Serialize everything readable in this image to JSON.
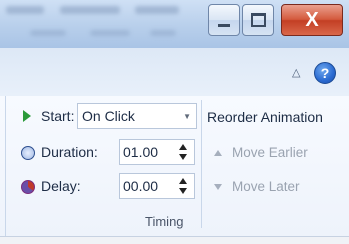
{
  "window": {
    "controls": {
      "minimize_icon": "minimize-icon",
      "maximize_icon": "maximize-icon",
      "close_label": "X"
    },
    "accent_close": "#d0523a"
  },
  "ribbon": {
    "collapse_icon": "caret-up-icon",
    "help_label": "?"
  },
  "timing": {
    "start": {
      "label": "Start:",
      "value": "On Click",
      "icon": "play-icon"
    },
    "duration": {
      "label": "Duration:",
      "value": "01.00",
      "icon": "clock-icon"
    },
    "delay": {
      "label": "Delay:",
      "value": "00.00",
      "icon": "delay-icon"
    },
    "group_label": "Timing"
  },
  "reorder": {
    "title": "Reorder Animation",
    "move_earlier": "Move Earlier",
    "move_later": "Move Later"
  }
}
